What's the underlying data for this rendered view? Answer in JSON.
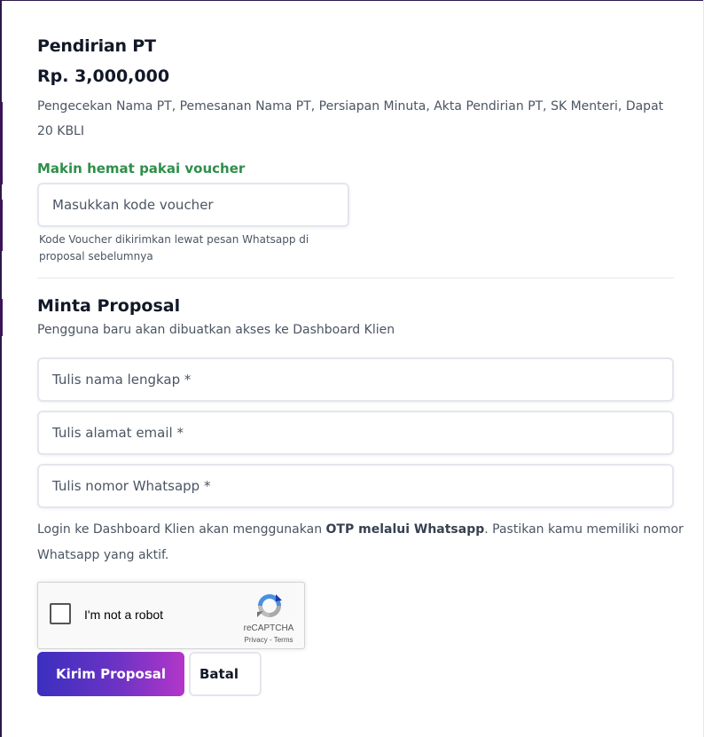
{
  "product": {
    "title": "Pendirian PT",
    "price": "Rp. 3,000,000",
    "description": "Pengecekan Nama PT, Pemesanan Nama PT, Persiapan Minuta, Akta Pendirian PT, SK Menteri, Dapat 20 KBLI"
  },
  "voucher": {
    "label": "Makin hemat pakai voucher",
    "placeholder": "Masukkan kode voucher",
    "hint": "Kode Voucher dikirimkan lewat pesan Whatsapp di proposal sebelumnya"
  },
  "proposal": {
    "title": "Minta Proposal",
    "subtitle": "Pengguna baru akan dibuatkan akses ke Dashboard Klien",
    "name_placeholder": "Tulis nama lengkap *",
    "email_placeholder": "Tulis alamat email *",
    "whatsapp_placeholder": "Tulis nomor Whatsapp *",
    "otp_note_before": "Login ke Dashboard Klien akan menggunakan ",
    "otp_note_bold": "OTP melalui Whatsapp",
    "otp_note_after": ". Pastikan kamu memiliki nomor Whatsapp yang aktif."
  },
  "recaptcha": {
    "label": "I'm not a robot",
    "brand": "reCAPTCHA",
    "privacy": "Privacy",
    "separator": " - ",
    "terms": "Terms",
    "icon": "recaptcha-logo-icon"
  },
  "actions": {
    "submit_label": "Kirim Proposal",
    "cancel_label": "Batal"
  },
  "colors": {
    "accent_start": "#3b2fbf",
    "accent_end": "#b336c9",
    "voucher_green": "#2f8f4a"
  }
}
